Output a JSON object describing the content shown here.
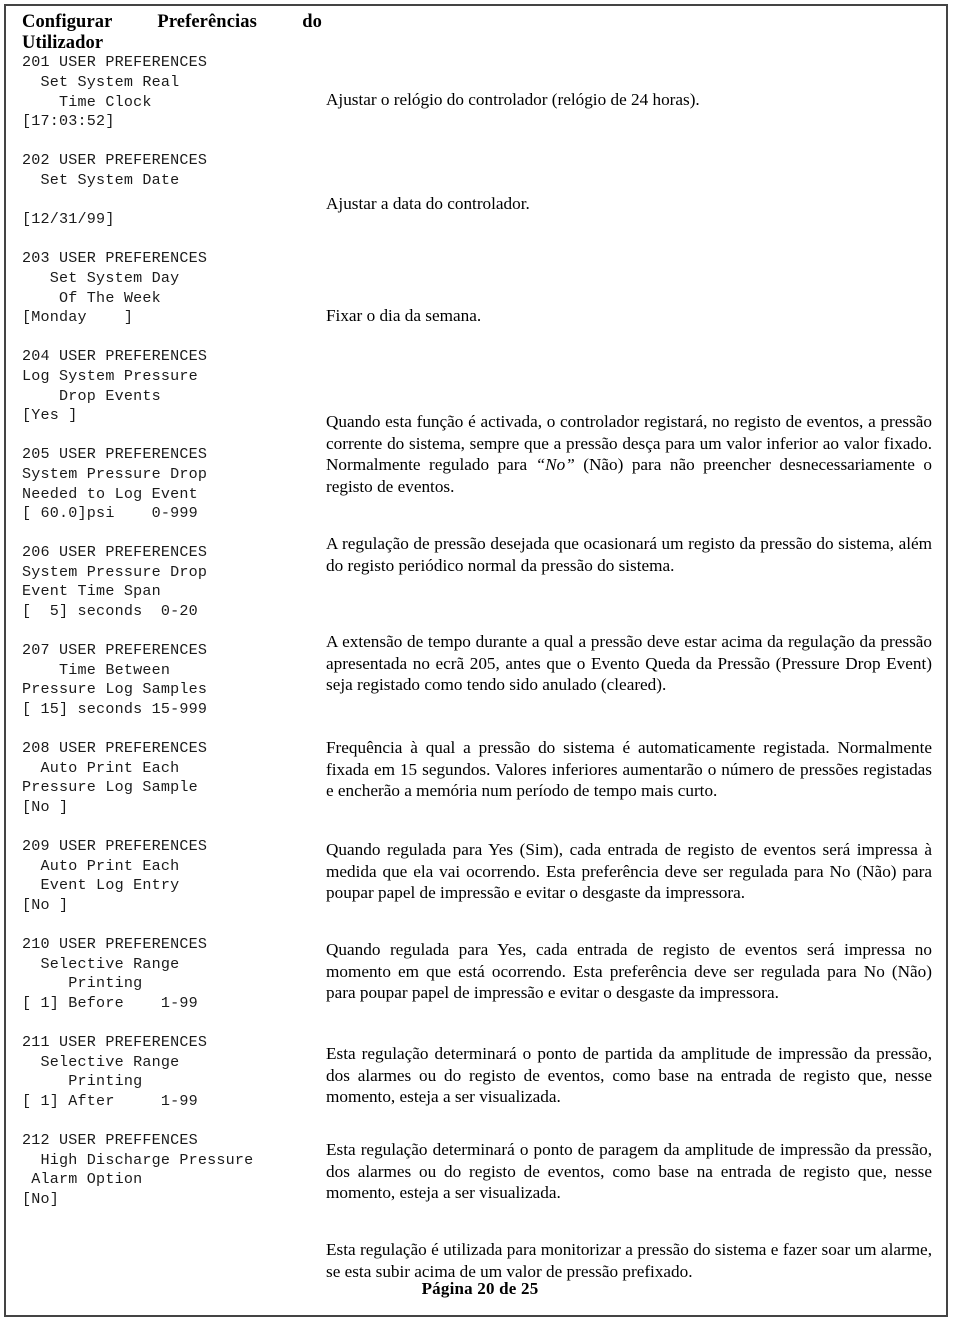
{
  "document": {
    "heading": "Configurar Preferências do Utilizador",
    "footer": "Página 20 de 25",
    "border_color": "#444444",
    "text_color": "#000000"
  },
  "settings": [
    {
      "code": "201",
      "screen_lines": [
        "201 USER PREFERENCES",
        "  Set System Real",
        "    Time Clock",
        "[17:03:52]"
      ],
      "screen_text": "201 USER PREFERENCES\n  Set System Real\n    Time Clock\n[17:03:52]",
      "title": "Set System Real Time Clock",
      "value": "[17:03:52]",
      "description": "Ajustar o relógio do controlador (relógio de 24 horas)."
    },
    {
      "code": "202",
      "screen_lines": [
        "202 USER PREFERENCES",
        "  Set System Date",
        "",
        "[12/31/99]"
      ],
      "screen_text": "202 USER PREFERENCES\n  Set System Date\n\n[12/31/99]",
      "title": "Set System Date",
      "value": "[12/31/99]",
      "description": "Ajustar a data do controlador."
    },
    {
      "code": "203",
      "screen_lines": [
        "203 USER PREFERENCES",
        "   Set System Day",
        "    Of The Week",
        "[Monday    ]"
      ],
      "screen_text": "203 USER PREFERENCES\n   Set System Day\n    Of The Week\n[Monday    ]",
      "title": "Set System Day Of The Week",
      "value": "[Monday    ]",
      "description": "Fixar o dia da semana."
    },
    {
      "code": "204",
      "screen_lines": [
        "204 USER PREFERENCES",
        "Log System Pressure",
        "    Drop Events",
        "[Yes ]"
      ],
      "screen_text": "204 USER PREFERENCES\nLog System Pressure\n    Drop Events\n[Yes ]",
      "title": "Log System Pressure Drop Events",
      "value": "[Yes ]",
      "description_html": "Quando esta função é activada, o controlador registará, no registo de eventos, a pressão corrente do sistema, sempre que a pressão desça para um valor inferior ao valor fixado. Normalmente regulado para <i>“No”</i> (Não) para não preencher desnecessariamente o registo de eventos.",
      "description": "Quando esta função é activada, o controlador registará, no registo de eventos, a pressão corrente do sistema, sempre que a pressão desça para um valor inferior ao valor fixado. Normalmente regulado para “No” (Não) para não preencher desnecessariamente o registo de eventos."
    },
    {
      "code": "205",
      "screen_lines": [
        "205 USER PREFERENCES",
        "System Pressure Drop",
        "Needed to Log Event",
        "[ 60.0]psi    0-999"
      ],
      "screen_text": "205 USER PREFERENCES\nSystem Pressure Drop\nNeeded to Log Event\n[ 60.0]psi    0-999",
      "title": "System Pressure Drop Needed to Log Event",
      "value": "[ 60.0]psi",
      "range": "0-999",
      "description": "A regulação de pressão desejada que ocasionará um registo da pressão do sistema, além do registo periódico normal da pressão do sistema."
    },
    {
      "code": "206",
      "screen_lines": [
        "206 USER PREFERENCES",
        "System Pressure Drop",
        "Event Time Span",
        "[  5] seconds  0-20"
      ],
      "screen_text": "206 USER PREFERENCES\nSystem Pressure Drop\nEvent Time Span\n[  5] seconds  0-20",
      "title": "System Pressure Drop Event Time Span",
      "value": "[  5] seconds",
      "range": "0-20",
      "description": "A extensão de tempo durante a qual a pressão deve estar acima da regulação da pressão apresentada no ecrã 205, antes que o Evento Queda da Pressão (Pressure Drop Event) seja registado como tendo sido anulado (cleared)."
    },
    {
      "code": "207",
      "screen_lines": [
        "207 USER PREFERENCES",
        "    Time Between",
        "Pressure Log Samples",
        "[ 15] seconds 15-999"
      ],
      "screen_text": "207 USER PREFERENCES\n    Time Between\nPressure Log Samples\n[ 15] seconds 15-999",
      "title": "Time Between Pressure Log Samples",
      "value": "[ 15] seconds",
      "range": "15-999",
      "description": "Frequência à qual a pressão do sistema é automaticamente registada. Normalmente fixada em 15 segundos. Valores inferiores aumentarão o número de pressões registadas e encherão a memória num período de tempo mais curto."
    },
    {
      "code": "208",
      "screen_lines": [
        "208 USER PREFERENCES",
        "  Auto Print Each",
        "Pressure Log Sample",
        "[No ]"
      ],
      "screen_text": "208 USER PREFERENCES\n  Auto Print Each\nPressure Log Sample\n[No ]",
      "title": "Auto Print Each Pressure Log Sample",
      "value": "[No ]",
      "description": "Quando regulada para Yes (Sim), cada entrada de registo de eventos será impressa à medida que ela vai ocorrendo. Esta preferência deve ser regulada para No (Não) para poupar papel de impressão e evitar o desgaste da impressora."
    },
    {
      "code": "209",
      "screen_lines": [
        "209 USER PREFERENCES",
        "  Auto Print Each",
        "  Event Log Entry",
        "[No ]"
      ],
      "screen_text": "209 USER PREFERENCES\n  Auto Print Each\n  Event Log Entry\n[No ]",
      "title": "Auto Print Each Event Log Entry",
      "value": "[No ]",
      "description": "Quando regulada para Yes, cada entrada de registo de eventos será impressa no momento em que está ocorrendo. Esta preferência deve ser regulada para No (Não) para poupar papel de impressão e evitar o desgaste da impressora."
    },
    {
      "code": "210",
      "screen_lines": [
        "210 USER PREFERENCES",
        "  Selective Range",
        "     Printing",
        "[ 1] Before    1-99"
      ],
      "screen_text": "210 USER PREFERENCES\n  Selective Range\n     Printing\n[ 1] Before    1-99",
      "title": "Selective Range Printing Before",
      "value": "[ 1] Before",
      "range": "1-99",
      "description": "Esta regulação determinará o ponto de partida da amplitude de impressão da pressão, dos alarmes ou do registo de eventos, como base na entrada de registo que, nesse momento, esteja a ser visualizada."
    },
    {
      "code": "211",
      "screen_lines": [
        "211 USER PREFERENCES",
        "  Selective Range",
        "     Printing",
        "[ 1] After     1-99"
      ],
      "screen_text": "211 USER PREFERENCES\n  Selective Range\n     Printing\n[ 1] After     1-99",
      "title": "Selective Range Printing After",
      "value": "[ 1] After",
      "range": "1-99",
      "description": "Esta regulação determinará o ponto de paragem da amplitude de impressão da pressão, dos alarmes ou do registo de eventos, como base na entrada de registo que, nesse momento, esteja a ser visualizada."
    },
    {
      "code": "212",
      "screen_lines": [
        "212 USER PREFFENCES",
        "  High Discharge Pressure",
        " Alarm Option",
        "[No]"
      ],
      "screen_text": "212 USER PREFFENCES\n  High Discharge Pressure\n Alarm Option\n[No]",
      "title": "High Discharge Pressure Alarm Option",
      "value": "[No]",
      "description": "Esta regulação é utilizada para monitorizar a pressão do sistema e fazer soar um alarme, se esta subir acima de um valor de pressão prefixado."
    }
  ]
}
